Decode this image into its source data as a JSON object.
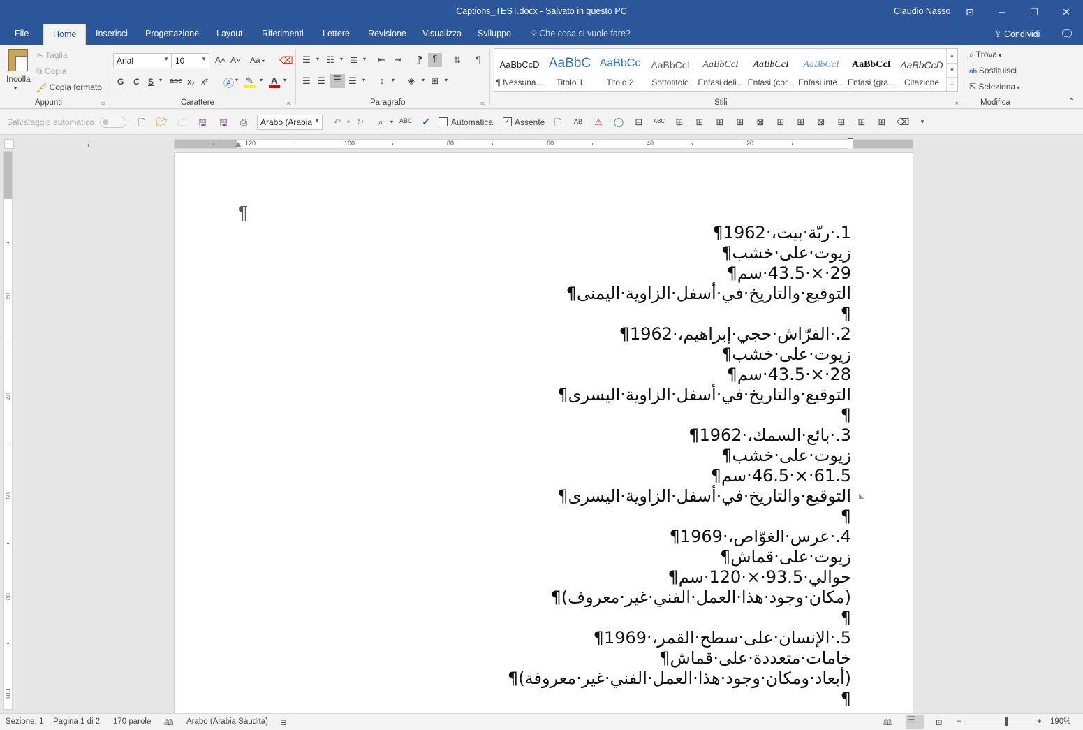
{
  "window": {
    "title": "Captions_TEST.docx - Salvato in questo PC",
    "user": "Claudio Nasso",
    "ribbon_display_icon": "ribbon-display-icon",
    "minimize_icon": "minimize-icon",
    "maximize_icon": "maximize-icon",
    "close_icon": "close-icon"
  },
  "tabs": [
    {
      "label": "File"
    },
    {
      "label": "Home",
      "active": true
    },
    {
      "label": "Inserisci"
    },
    {
      "label": "Progettazione"
    },
    {
      "label": "Layout"
    },
    {
      "label": "Riferimenti"
    },
    {
      "label": "Lettere"
    },
    {
      "label": "Revisione"
    },
    {
      "label": "Visualizza"
    },
    {
      "label": "Sviluppo"
    }
  ],
  "tellme": "Che cosa si vuole fare?",
  "share": "Condividi",
  "clipboard": {
    "paste": "Incolla",
    "cut": "Taglia",
    "copy": "Copia",
    "format_painter": "Copia formato",
    "group": "Appunti"
  },
  "font": {
    "name": "Arial",
    "size": "10",
    "group": "Carattere",
    "bold": "G",
    "italic": "C",
    "underline": "S",
    "strike": "abc",
    "subscript": "x₂",
    "superscript": "x²",
    "grow": "A˄",
    "shrink": "A˅",
    "case": "Aa"
  },
  "paragraph": {
    "group": "Paragrafo"
  },
  "styles": {
    "group": "Stili",
    "items": [
      {
        "sample": "AaBbCcD",
        "name": "¶ Nessuna..."
      },
      {
        "sample": "AaBbC",
        "name": "Titolo 1"
      },
      {
        "sample": "AaBbCc",
        "name": "Titolo 2"
      },
      {
        "sample": "AaBbCcI",
        "name": "Sottotitolo"
      },
      {
        "sample": "AaBbCcI",
        "name": "Enfasi deli..."
      },
      {
        "sample": "AaBbCcI",
        "name": "Enfasi (cor..."
      },
      {
        "sample": "AaBbCcI",
        "name": "Enfasi inte..."
      },
      {
        "sample": "AaBbCcI",
        "name": "Enfasi (gra..."
      },
      {
        "sample": "AaBbCcD",
        "name": "Citazione"
      }
    ]
  },
  "editing": {
    "group": "Modifica",
    "find": "Trova",
    "replace": "Sostituisci",
    "select": "Seleziona"
  },
  "qat": {
    "autosave": "Salvataggio automatico",
    "language": "Arabo (Arabia",
    "automatica": "Automatica",
    "assente": "Assente"
  },
  "ruler": {
    "h_labels": [
      "120",
      "100",
      "80",
      "60",
      "40",
      "20"
    ],
    "v_labels": [
      "20",
      "40",
      "60",
      "80",
      "100"
    ]
  },
  "document": {
    "top_pilcrow": "¶",
    "lines": [
      "1.·ربّة·بيت،·1962¶",
      "زيوت·على·خشب¶",
      "29·×·43.5·سم¶",
      "التوقيع·والتاريخ·في·أسفل·الزاوية·اليمنى¶",
      "¶",
      "2.·الفرّاش·حجي·إبراهيم،·1962¶",
      "زيوت·على·خشب¶",
      "28·×·43.5·سم¶",
      "التوقيع·والتاريخ·في·أسفل·الزاوية·اليسرى¶",
      "¶",
      "3.·بائع·السمك،·1962¶",
      "زيوت·على·خشب¶",
      "61.5·×·46.5·سم¶",
      "التوقيع·والتاريخ·في·أسفل·الزاوية·اليسرى¶",
      "¶",
      "4.·عرس·الغوّاص،·1969¶",
      "زيوت·على·قماش¶",
      "حوالي·93.5·×·120·سم¶",
      "(مكان·وجود·هذا·العمل·الفني·غير·معروف)¶",
      "¶",
      "5.·الإنسان·على·سطح·القمر،·1969¶",
      "خامات·متعددة·على·قماش¶",
      "(أبعاد·ومكان·وجود·هذا·العمل·الفني·غير·معروفة)¶",
      "¶"
    ]
  },
  "status": {
    "section": "Sezione: 1",
    "page": "Pagina 1 di 2",
    "words": "170 parole",
    "language": "Arabo (Arabia Saudita)",
    "zoom": "190%"
  },
  "colors": {
    "accent": "#2b579a",
    "ribbon_bg": "#f3f3f3",
    "doc_bg": "#e6e6e6"
  }
}
